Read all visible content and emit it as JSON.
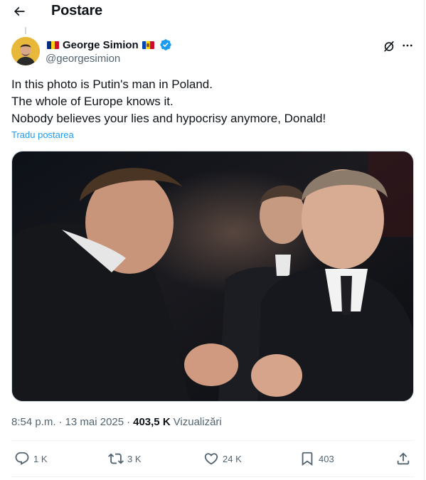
{
  "header": {
    "title": "Postare",
    "back_icon": "arrow-left-icon"
  },
  "author": {
    "name": "George Simion",
    "handle": "@georgesimion",
    "verified": true,
    "flags": [
      "Romania",
      "Moldova"
    ]
  },
  "post": {
    "lines": [
      "In this photo is Putin's man in Poland.",
      "The whole of Europe knows it.",
      "Nobody believes your lies and hypocrisy anymore, Donald!"
    ],
    "translate_label": "Tradu postarea"
  },
  "meta": {
    "time": "8:54 p.m.",
    "date": "13 mai 2025",
    "views_count": "403,5 K",
    "views_label": "Vizualizări",
    "separator": "·"
  },
  "actions": {
    "replies": "1 K",
    "reposts": "3 K",
    "likes": "24 K",
    "bookmarks": "403"
  },
  "colors": {
    "text": "#0f1419",
    "secondary": "#536471",
    "accent": "#1d9bf0",
    "border": "#eff3f4"
  }
}
